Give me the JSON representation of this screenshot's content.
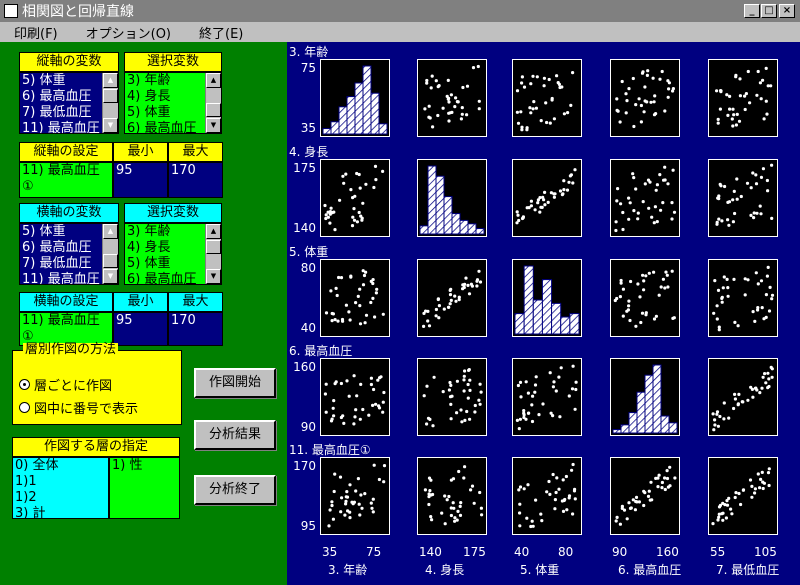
{
  "window": {
    "title": "相関図と回帰直線",
    "controls": [
      "_",
      "□",
      "×"
    ]
  },
  "menu": [
    "印刷(F)",
    "オプション(O)",
    "終了(E)"
  ],
  "y_axis_vars": {
    "label": "縦軸の変数",
    "items": [
      "5) 体重",
      "6) 最高血圧",
      "7) 最低血圧",
      "11) 最高血圧"
    ]
  },
  "y_select": {
    "label": "選択変数",
    "items": [
      "3) 年齢",
      "4) 身長",
      "5) 体重",
      "6) 最高血圧"
    ]
  },
  "y_setting": {
    "label": "縦軸の設定",
    "min_label": "最小",
    "max_label": "最大",
    "var": "11) 最高血圧",
    "var2": "①",
    "min": "95",
    "max": "170"
  },
  "x_axis_vars": {
    "label": "横軸の変数",
    "items": [
      "5) 体重",
      "6) 最高血圧",
      "7) 最低血圧",
      "11) 最高血圧"
    ]
  },
  "x_select": {
    "label": "選択変数",
    "items": [
      "3) 年齢",
      "4) 身長",
      "5) 体重",
      "6) 最高血圧"
    ]
  },
  "x_setting": {
    "label": "横軸の設定",
    "min_label": "最小",
    "max_label": "最大",
    "var": "11) 最高血圧",
    "var2": "①",
    "min": "95",
    "max": "170"
  },
  "strat": {
    "label": "層別作図の方法",
    "opt1": "層ごとに作図",
    "opt2": "図中に番号で表示"
  },
  "layers": {
    "label": "作図する層の指定",
    "items": [
      "0) 全体",
      "1)1",
      "1)2",
      "3) 計"
    ],
    "right": "1) 性"
  },
  "buttons": {
    "start": "作図開始",
    "results": "分析結果",
    "end": "分析終了"
  },
  "plot": {
    "rows": [
      {
        "title": "3. 年齢",
        "ymax": "75",
        "ymin": "35"
      },
      {
        "title": "4. 身長",
        "ymax": "175",
        "ymin": "140"
      },
      {
        "title": "5. 体重",
        "ymax": "80",
        "ymin": "40"
      },
      {
        "title": "6. 最高血圧",
        "ymax": "160",
        "ymin": "90"
      },
      {
        "title": "11. 最高血圧①",
        "ymax": "170",
        "ymin": "95"
      }
    ],
    "cols": [
      {
        "title": "3. 年齢",
        "xmin": "35",
        "xmax": "75"
      },
      {
        "title": "4. 身長",
        "xmin": "140",
        "xmax": "175"
      },
      {
        "title": "5. 体重",
        "xmin": "40",
        "xmax": "80"
      },
      {
        "title": "6. 最高血圧",
        "xmin": "90",
        "xmax": "160"
      },
      {
        "title": "7. 最低血圧",
        "xmin": "55",
        "xmax": "105"
      }
    ],
    "hist": [
      [
        0.08,
        0.18,
        0.4,
        0.55,
        0.75,
        1.0,
        0.6,
        0.15
      ],
      [
        0.12,
        1.0,
        0.85,
        0.55,
        0.3,
        0.2,
        0.15,
        0.08
      ],
      [
        0.3,
        1.0,
        0.5,
        0.8,
        0.45,
        0.25,
        0.3
      ],
      [
        0.05,
        0.12,
        0.3,
        0.6,
        0.85,
        1.0,
        0.25,
        0.15
      ]
    ]
  }
}
